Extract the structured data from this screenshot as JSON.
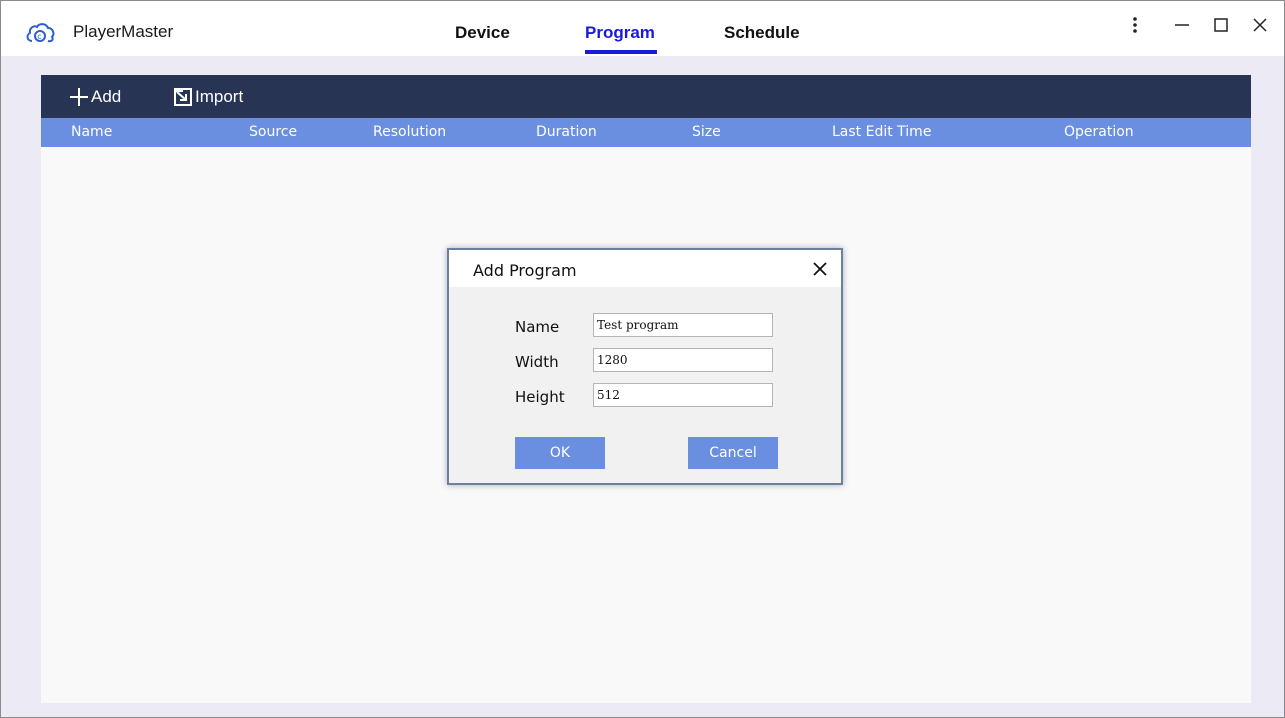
{
  "app": {
    "title": "PlayerMaster",
    "logo_icon": "cloud-icon"
  },
  "nav": {
    "tabs": [
      {
        "label": "Device",
        "active": false
      },
      {
        "label": "Program",
        "active": true
      },
      {
        "label": "Schedule",
        "active": false
      }
    ],
    "active_color": "#1a1adb"
  },
  "window_controls": {
    "menu_icon": "vertical-dots-icon",
    "minimize_icon": "minimize-icon",
    "maximize_icon": "maximize-icon",
    "close_icon": "close-icon"
  },
  "toolbar": {
    "add_label": "Add",
    "import_label": "Import",
    "background": "#283453"
  },
  "table": {
    "header_color": "#6a8fe0",
    "columns": [
      "Name",
      "Source",
      "Resolution",
      "Duration",
      "Size",
      "Last Edit Time",
      "Operation"
    ],
    "rows": []
  },
  "dialog": {
    "title": "Add Program",
    "fields": [
      {
        "label": "Name",
        "value": "Test program"
      },
      {
        "label": "Width",
        "value": "1280"
      },
      {
        "label": "Height",
        "value": "512"
      }
    ],
    "ok_label": "OK",
    "cancel_label": "Cancel"
  }
}
